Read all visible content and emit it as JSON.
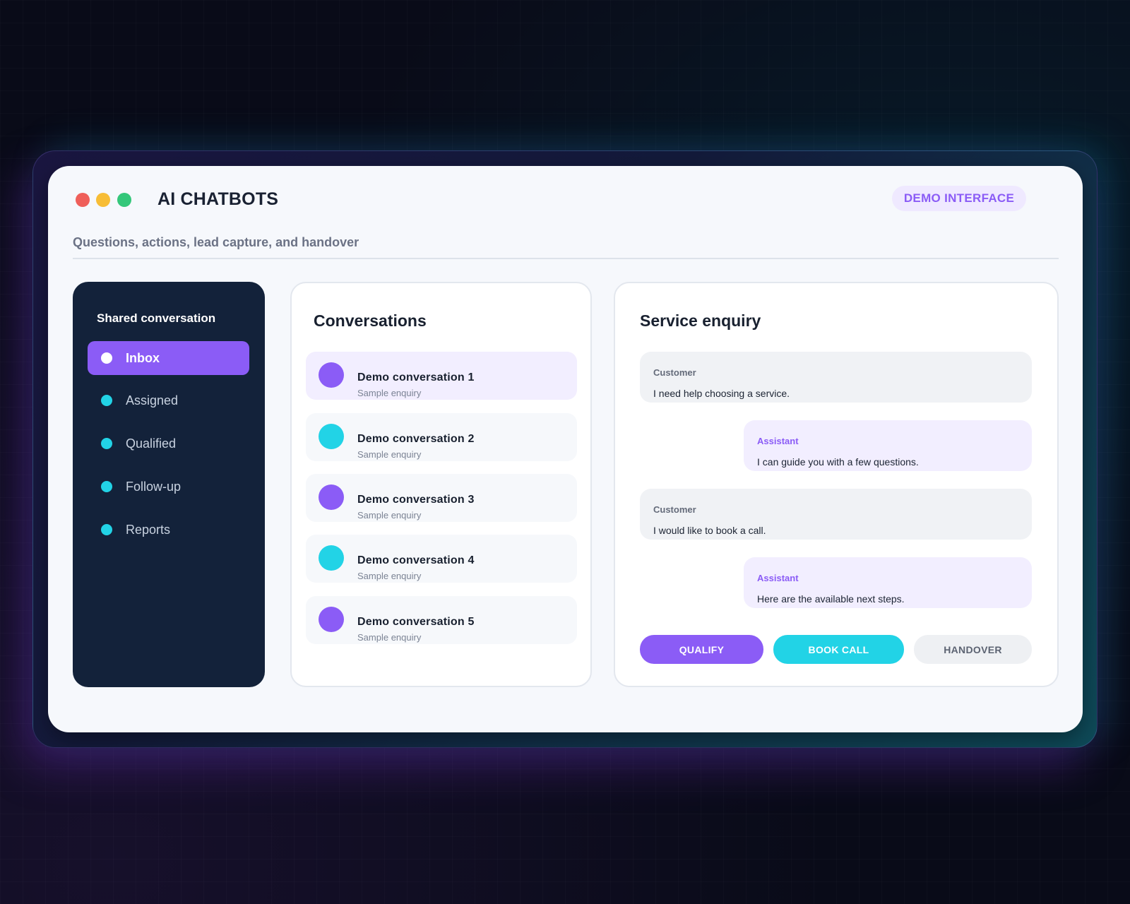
{
  "window": {
    "title": "AI CHATBOTS",
    "badge": "DEMO INTERFACE",
    "subtitle": "Questions, actions, lead capture, and handover"
  },
  "sidebar": {
    "title": "Shared conversation",
    "items": [
      {
        "label": "Inbox",
        "active": true,
        "dot_color": "#ffffff"
      },
      {
        "label": "Assigned",
        "active": false,
        "dot_color": "#22d3e6"
      },
      {
        "label": "Qualified",
        "active": false,
        "dot_color": "#22d3e6"
      },
      {
        "label": "Follow-up",
        "active": false,
        "dot_color": "#22d3e6"
      },
      {
        "label": "Reports",
        "active": false,
        "dot_color": "#22d3e6"
      }
    ]
  },
  "conversations": {
    "title": "Conversations",
    "items": [
      {
        "name": "Demo conversation 1",
        "subtitle": "Sample enquiry",
        "avatar_color": "#8b5cf6",
        "selected": true
      },
      {
        "name": "Demo conversation 2",
        "subtitle": "Sample enquiry",
        "avatar_color": "#22d3e6",
        "selected": false
      },
      {
        "name": "Demo conversation 3",
        "subtitle": "Sample enquiry",
        "avatar_color": "#8b5cf6",
        "selected": false
      },
      {
        "name": "Demo conversation 4",
        "subtitle": "Sample enquiry",
        "avatar_color": "#22d3e6",
        "selected": false
      },
      {
        "name": "Demo conversation 5",
        "subtitle": "Sample enquiry",
        "avatar_color": "#8b5cf6",
        "selected": false
      }
    ]
  },
  "chat": {
    "title": "Service enquiry",
    "messages": [
      {
        "role": "Customer",
        "text": "I need help choosing a service."
      },
      {
        "role": "Assistant",
        "text": "I can guide you with a few questions."
      },
      {
        "role": "Customer",
        "text": "I would like to book a call."
      },
      {
        "role": "Assistant",
        "text": "Here are the available next steps."
      }
    ],
    "actions": {
      "qualify": "QUALIFY",
      "book_call": "BOOK CALL",
      "handover": "HANDOVER"
    }
  },
  "colors": {
    "accent_purple": "#8b5cf6",
    "accent_cyan": "#22d3e6",
    "sidebar_bg": "#13223a",
    "window_bg": "#f6f8fc"
  }
}
